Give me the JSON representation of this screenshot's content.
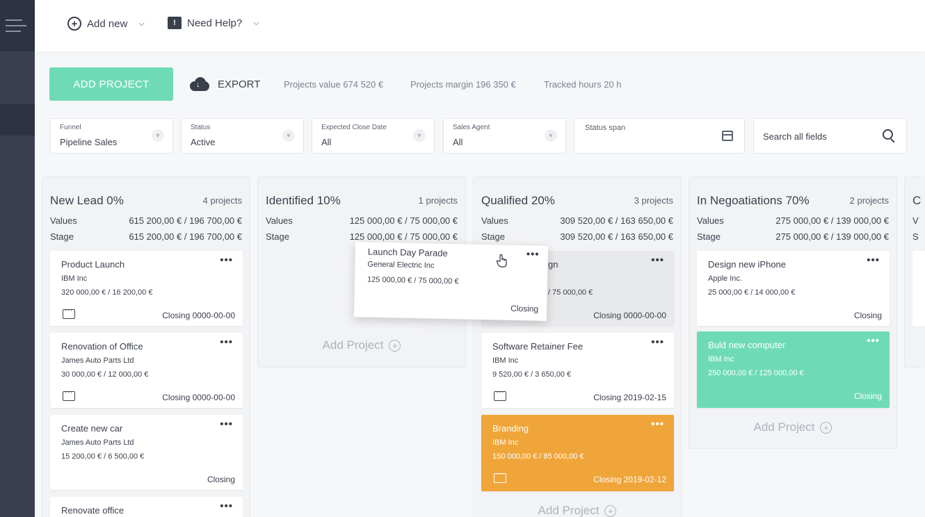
{
  "topbar": {
    "add_new": "Add new",
    "need_help": "Need Help?"
  },
  "toolbar": {
    "add_project": "ADD PROJECT",
    "export": "EXPORT",
    "projects_value": "Projects value 674 520 €",
    "projects_margin": "Projects margin 196 350 €",
    "tracked_hours": "Tracked hours 20 h"
  },
  "filters": {
    "funnel": {
      "label": "Funnel",
      "value": "Pipeline Sales"
    },
    "status": {
      "label": "Status",
      "value": "Active"
    },
    "close_date": {
      "label": "Expected Close Date",
      "value": "All"
    },
    "sales_agent": {
      "label": "Sales Agent",
      "value": "All"
    },
    "status_span": {
      "label": "Status span"
    },
    "search": {
      "placeholder": "Search all fields"
    }
  },
  "labels": {
    "values": "Values",
    "stage": "Stage",
    "add_project": "Add Project"
  },
  "columns": [
    {
      "title": "New Lead 0%",
      "count": "4 projects",
      "values": "615 200,00 € / 196 700,00 €",
      "stage": "615 200,00 € / 196 700,00 €",
      "cards": [
        {
          "title": "Product Launch",
          "company": "IBM Inc",
          "value": "320 000,00 € / 16 200,00 €",
          "closing": "Closing 0000-00-00"
        },
        {
          "title": "Renovation of Office",
          "company": "James Auto Parts Ltd",
          "value": "30 000,00 € / 12 000,00 €",
          "closing": "Closing 0000-00-00"
        },
        {
          "title": "Create new car",
          "company": "James Auto Parts Ltd",
          "value": "15 200,00 € / 6 500,00 €",
          "closing": "Closing"
        },
        {
          "title": "Renovate office"
        }
      ]
    },
    {
      "title": "Identified 10%",
      "count": "1 projects",
      "values": "125 000,00 € / 75 000,00 €",
      "stage": "125 000,00 € / 75 000,00 €"
    },
    {
      "title": "Qualified 20%",
      "count": "3 projects",
      "values": "309 520,00 € / 163 650,00 €",
      "stage": "309 520,00 € / 163 650,00 €",
      "cards": [
        {
          "title_fragment": "gn",
          "value_fragment": "/ 75 000,00 €",
          "closing": "Closing 0000-00-00"
        },
        {
          "title": "Software Retainer Fee",
          "company": "IBM Inc",
          "value": "9 520,00 € / 3 650,00 €",
          "closing": "Closing 2019-02-15"
        },
        {
          "title": "Branding",
          "company": "IBM Inc",
          "value": "150 000,00 € / 85 000,00 €",
          "closing": "Closing 2019-02-12"
        }
      ]
    },
    {
      "title": "In Negoatiations 70%",
      "count": "2 projects",
      "values": "275 000,00 € / 139 000,00 €",
      "stage": "275 000,00 € / 139 000,00 €",
      "cards": [
        {
          "title": "Design new iPhone",
          "company": "Apple Inc.",
          "value": "25 000,00 € / 14 000,00 €",
          "closing": "Closing"
        },
        {
          "title": "Buld new computer",
          "company": "IBM Inc",
          "value": "250 000,00 € / 125 000,00 €",
          "closing": "Closing"
        }
      ]
    },
    {
      "title_fragment": "C",
      "values_fragment": "V",
      "stage_fragment": "S"
    }
  ],
  "dragged_card": {
    "title": "Launch Day Parade",
    "company": "General Electric Inc",
    "value": "125 000,00 € / 75 000,00 €",
    "closing": "Closing"
  },
  "colors": {
    "sidebar": "#3a4052",
    "accent_green": "#6fdbb6",
    "accent_orange": "#f0a53a"
  }
}
